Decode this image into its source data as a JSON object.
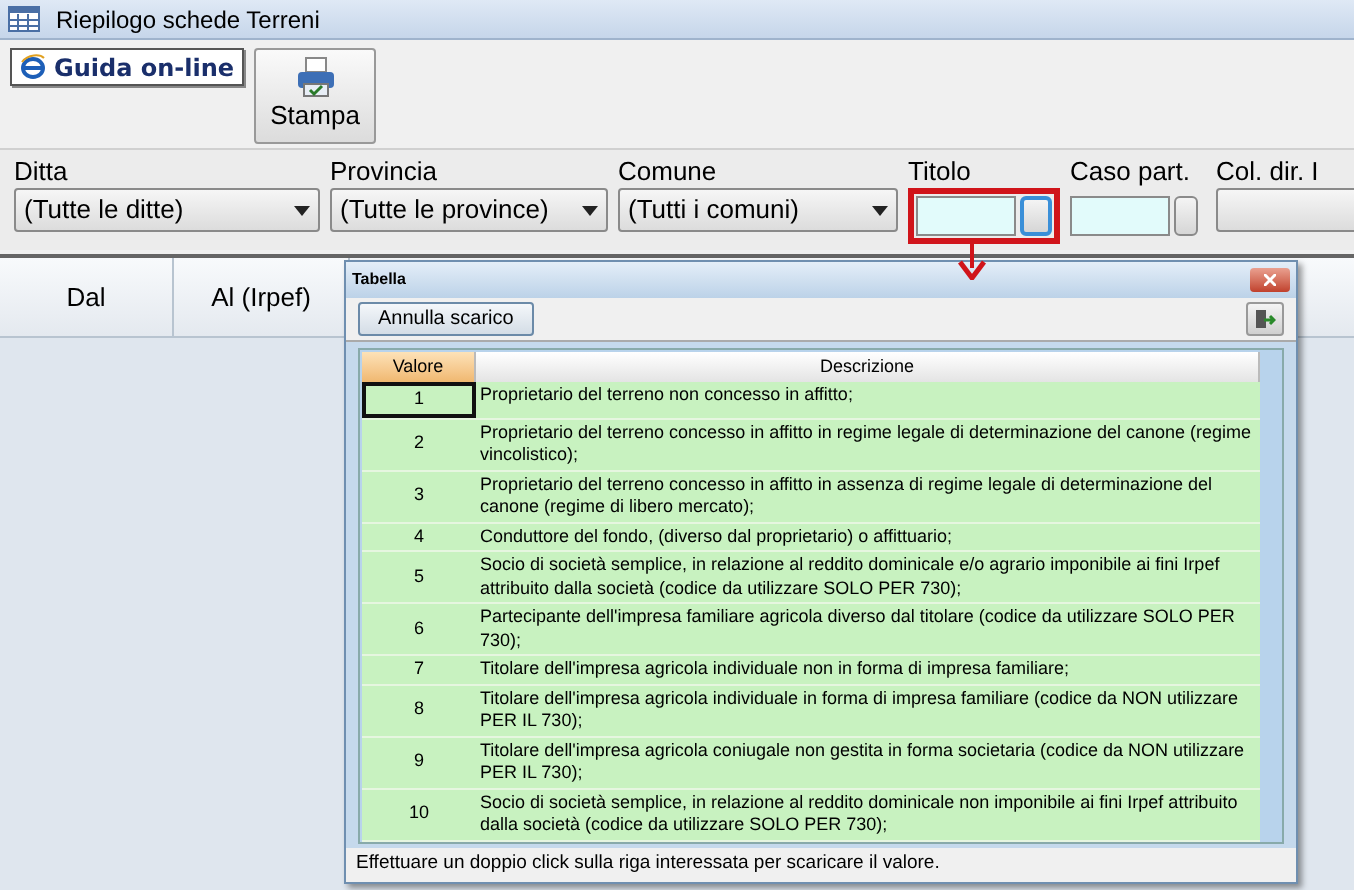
{
  "window": {
    "title": "Riepilogo schede Terreni"
  },
  "toolbar": [
    {
      "kind": "link",
      "label": "Guida on-line"
    },
    {
      "kind": "print",
      "label": "Stampa"
    }
  ],
  "filters": [
    {
      "kind": "dropdown",
      "label": "Ditta",
      "value": "(Tutte le ditte)"
    },
    {
      "kind": "dropdown",
      "label": "Provincia",
      "value": "(Tutte le province)"
    },
    {
      "kind": "dropdown",
      "label": "Comune",
      "value": "(Tutti i comuni)"
    },
    {
      "kind": "lookup",
      "label": "Titolo",
      "highlighted": true
    },
    {
      "kind": "lookup",
      "label": "Caso part.",
      "highlighted": false
    },
    {
      "kind": "partial",
      "label": "Col. dir. I"
    }
  ],
  "grid": {
    "columns": [
      "Dal",
      "Al (Irpef)"
    ]
  },
  "dialog": {
    "title": "Tabella",
    "button": "Annulla scarico",
    "columns": [
      "Valore",
      "Descrizione"
    ],
    "rows": [
      {
        "value": "1",
        "description": "Proprietario del terreno non concesso in affitto;",
        "selected": true
      },
      {
        "value": "2",
        "description": "Proprietario del terreno concesso in affitto in regime legale di determinazione del canone (regime vincolistico);",
        "selected": false
      },
      {
        "value": "3",
        "description": "Proprietario del terreno concesso in affitto in assenza di regime legale di determinazione del canone (regime di libero mercato);",
        "selected": false
      },
      {
        "value": "4",
        "description": "Conduttore del fondo, (diverso dal proprietario) o affittuario;",
        "selected": false
      },
      {
        "value": "5",
        "description": "Socio di società semplice, in relazione al reddito dominicale e/o agrario imponibile ai fini Irpef attribuito dalla società (codice da utilizzare SOLO PER 730);",
        "selected": false
      },
      {
        "value": "6",
        "description": "Partecipante dell'impresa familiare agricola diverso dal titolare (codice da utilizzare SOLO PER 730);",
        "selected": false
      },
      {
        "value": "7",
        "description": "Titolare dell'impresa agricola individuale non in forma di impresa familiare;",
        "selected": false
      },
      {
        "value": "8",
        "description": "Titolare dell'impresa agricola individuale in forma di impresa familiare (codice da NON utilizzare PER IL 730);",
        "selected": false
      },
      {
        "value": "9",
        "description": "Titolare dell'impresa agricola coniugale non gestita in forma societaria (codice da NON utilizzare PER IL 730);",
        "selected": false
      },
      {
        "value": "10",
        "description": "Socio di società semplice, in relazione al reddito dominicale non imponibile ai fini Irpef attribuito dalla società (codice da utilizzare SOLO PER 730);",
        "selected": false
      }
    ],
    "hint": "Effettuare un doppio click sulla riga interessata per scaricare il valore."
  }
}
